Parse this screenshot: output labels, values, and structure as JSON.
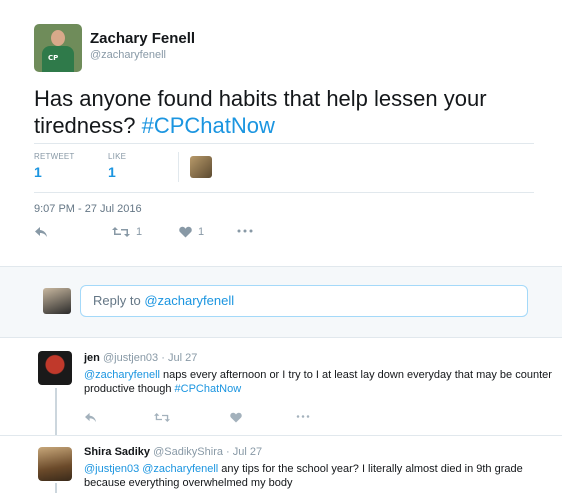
{
  "tweet": {
    "author_name": "Zachary Fenell",
    "author_handle": "@zacharyfenell",
    "avatar_text": "CP",
    "text_plain": "Has anyone found habits that help lessen your tiredness? ",
    "hashtag": "#CPChatNow",
    "retweet_label": "RETWEET",
    "retweet_count": "1",
    "like_label": "LIKE",
    "like_count": "1",
    "timestamp": "9:07 PM - 27 Jul 2016",
    "action_retweet_count": "1",
    "action_like_count": "1"
  },
  "reply_box": {
    "placeholder_prefix": "Reply to ",
    "placeholder_mention": "@zacharyfenell"
  },
  "replies": [
    {
      "name": "jen",
      "handle": "@justjen03",
      "time": "· Jul 27",
      "mention": "@zacharyfenell",
      "text": " naps every afternoon or I try to I at least lay down everyday that may be counter productive though ",
      "hashtag": "#CPChatNow"
    },
    {
      "name": "Shira Sadiky",
      "handle": "@SadikyShira",
      "time": "· Jul 27",
      "mention1": "@justjen03",
      "mention2": "@zacharyfenell",
      "text": " any tips for the school year? I literally almost died in 9th grade because everything overwhelmed my body"
    }
  ],
  "colors": {
    "accent": "#1b95e0",
    "muted": "#8899a6",
    "text": "#14171a"
  }
}
